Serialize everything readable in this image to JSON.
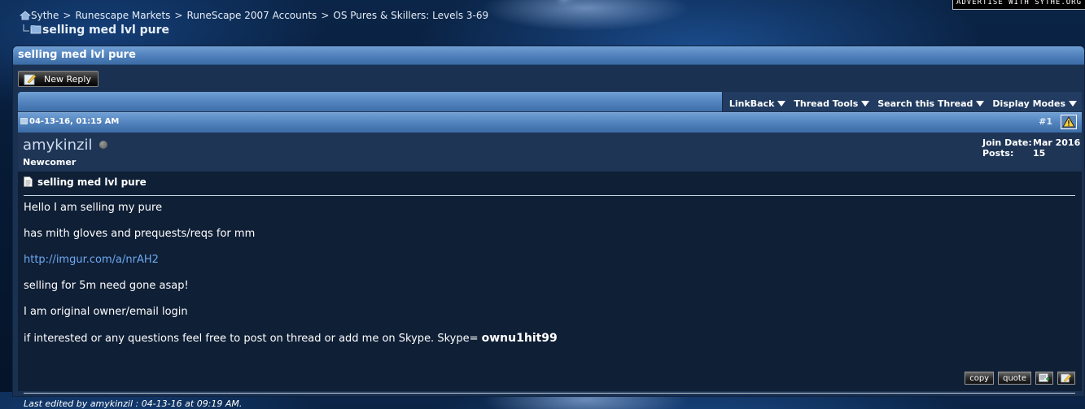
{
  "header": {
    "ad_text": "ADVERTISE WITH SYTHE.ORG",
    "breadcrumb": [
      "Sythe",
      "Runescape Markets",
      "RuneScape 2007 Accounts",
      "OS Pures & Skillers: Levels 3-69"
    ],
    "breadcrumb_separator": ">",
    "current_thread": "selling med lvl pure"
  },
  "thread": {
    "title": "selling med lvl pure",
    "new_reply_label": "New Reply",
    "menus": [
      "LinkBack",
      "Thread Tools",
      "Search this Thread",
      "Display Modes"
    ]
  },
  "post": {
    "date": "04-13-16, 01:15 AM",
    "number": "#1",
    "username": "amykinzil",
    "user_title": "Newcomer",
    "join_date_label": "Join Date:",
    "join_date": "Mar 2016",
    "posts_label": "Posts:",
    "posts": "15",
    "title": "selling med lvl pure",
    "lines": [
      "Hello I am selling my pure",
      "has mith gloves and prequests/reqs for mm",
      "http://imgur.com/a/nrAH2",
      "selling for 5m need gone asap!",
      "I am original owner/email login",
      "if interested or any questions feel free to post on thread or add me on Skype. Skype="
    ],
    "skype_id": "ownu1hit99",
    "edited_note": "Last edited by amykinzil : 04-13-16 at 09:19 AM.",
    "buttons": {
      "copy": "copy",
      "quote": "quote"
    }
  },
  "colors": {
    "link": "#6fa9f0",
    "header_blue": "#4f80bb",
    "panel_bg": "#1a3151",
    "post_bg": "#0f1f36"
  },
  "icons": [
    "home-icon",
    "folder-icon",
    "new-reply-icon",
    "menu-arrow-icon",
    "post-icon",
    "report-icon",
    "online-status-icon",
    "document-icon",
    "multiquote-icon",
    "quick-reply-icon"
  ]
}
